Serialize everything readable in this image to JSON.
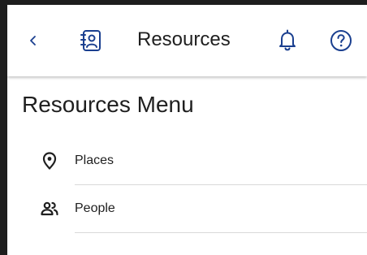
{
  "header": {
    "title": "Resources",
    "icons": {
      "back": "chevron-left-icon",
      "contacts": "contact-book-icon",
      "notifications": "bell-icon",
      "help": "help-circle-icon"
    },
    "accent_color": "#1a3f8f"
  },
  "page": {
    "title": "Resources Menu"
  },
  "menu": {
    "items": [
      {
        "label": "Places",
        "icon": "location-pin-icon"
      },
      {
        "label": "People",
        "icon": "people-icon"
      }
    ]
  }
}
